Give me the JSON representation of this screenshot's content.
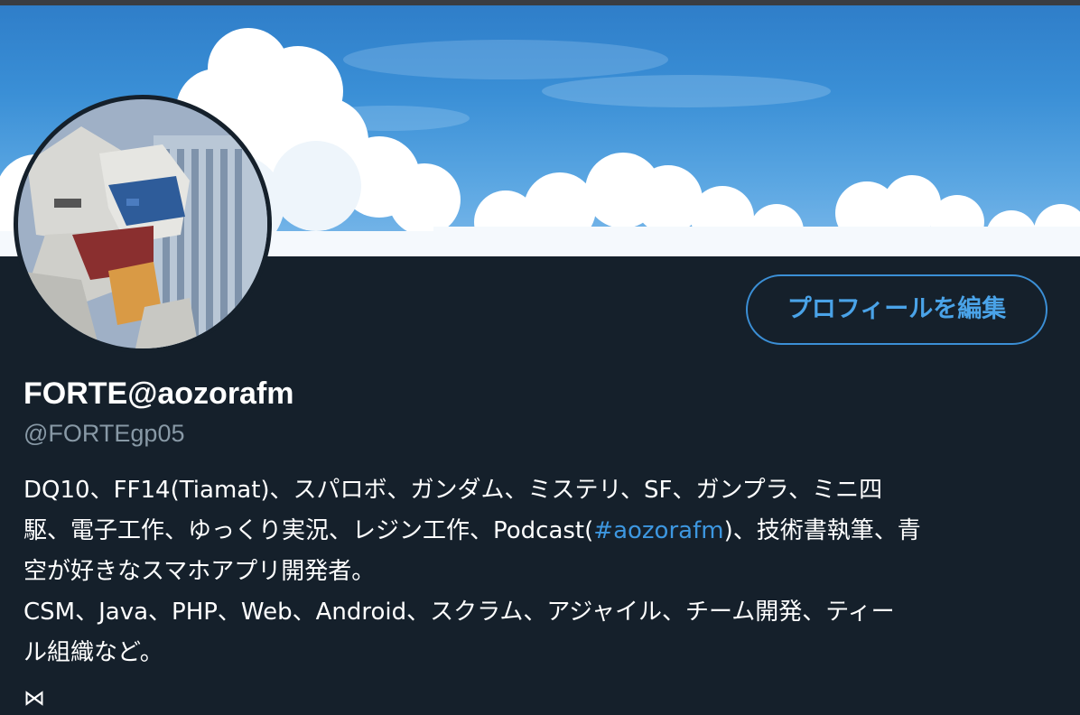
{
  "profile": {
    "display_name": "FORTE@aozorafm",
    "handle": "@FORTEgp05",
    "edit_button_label": "プロフィールを編集",
    "bio": {
      "line1": "DQ10、FF14(Tiamat)、スパロボ、ガンダム、ミステリ、SF、ガンプラ、ミニ四",
      "line2_prefix": "駆、電子工作、ゆっくり実況、レジン工作、Podcast(",
      "hashtag": "#aozorafm",
      "line2_suffix": ")、技術書執筆、青",
      "line3": "空が好きなスマホアプリ開発者。",
      "line4": "CSM、Java、PHP、Web、Android、スクラム、アジャイル、チーム開発、ティー",
      "line5": "ル組織など。"
    },
    "extra_glyph": "⋈"
  },
  "images": {
    "banner": "sky-with-clouds-banner",
    "avatar": "gundam-statue-avatar"
  },
  "colors": {
    "background": "#15202b",
    "accent": "#3d97e0",
    "secondary_text": "#8899a6"
  }
}
